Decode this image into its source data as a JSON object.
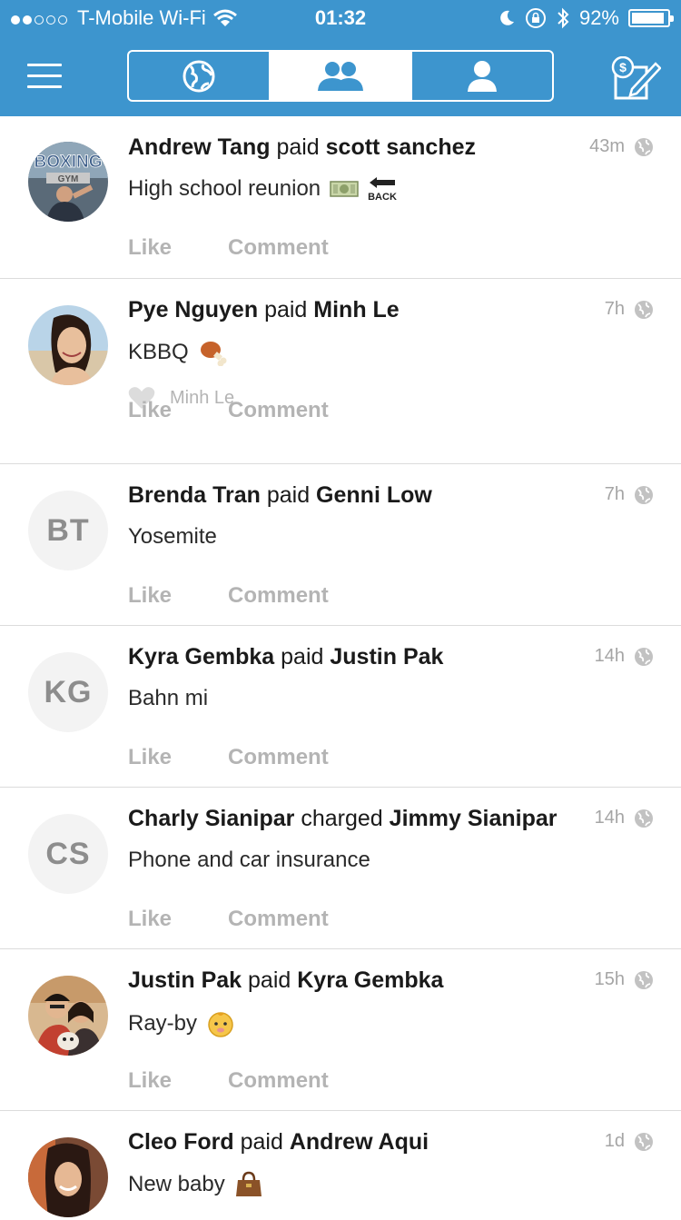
{
  "status_bar": {
    "carrier": "T-Mobile Wi-Fi",
    "time": "01:32",
    "battery": "92%",
    "signal_bars_filled": 2,
    "signal_bars_total": 5
  },
  "colors": {
    "header": "#3d95ce",
    "muted": "#b4b4b4",
    "separator": "#dcdcdc"
  },
  "header": {
    "tabs": [
      {
        "icon": "globe-icon",
        "active": false
      },
      {
        "icon": "friends-icon",
        "active": true
      },
      {
        "icon": "person-icon",
        "active": false
      }
    ]
  },
  "actions": {
    "like": "Like",
    "comment": "Comment"
  },
  "feed": [
    {
      "actor": "Andrew Tang",
      "verb": "paid",
      "target": "scott sanchez",
      "time": "43m",
      "note": "High school reunion",
      "avatar": "photo-boxing"
    },
    {
      "actor": "Pye Nguyen",
      "verb": "paid",
      "target": "Minh Le",
      "time": "7h",
      "note": "KBBQ",
      "liked_by": "Minh Le",
      "avatar": "photo-woman"
    },
    {
      "actor": "Brenda Tran",
      "verb": "paid",
      "target": "Genni Low",
      "time": "7h",
      "note": "Yosemite",
      "avatar_initials": "BT"
    },
    {
      "actor": "Kyra Gembka",
      "verb": "paid",
      "target": "Justin Pak",
      "time": "14h",
      "note": "Bahn mi",
      "avatar_initials": "KG"
    },
    {
      "actor": "Charly Sianipar",
      "verb": "charged",
      "target": "Jimmy Sianipar",
      "time": "14h",
      "note": "Phone and car insurance",
      "avatar_initials": "CS"
    },
    {
      "actor": "Justin Pak",
      "verb": "paid",
      "target": "Kyra Gembka",
      "time": "15h",
      "note": "Ray-by",
      "avatar": "photo-couple"
    },
    {
      "actor": "Cleo Ford",
      "verb": "paid",
      "target": "Andrew Aqui",
      "time": "1d",
      "note": "New baby",
      "avatar": "photo-woman2"
    }
  ]
}
